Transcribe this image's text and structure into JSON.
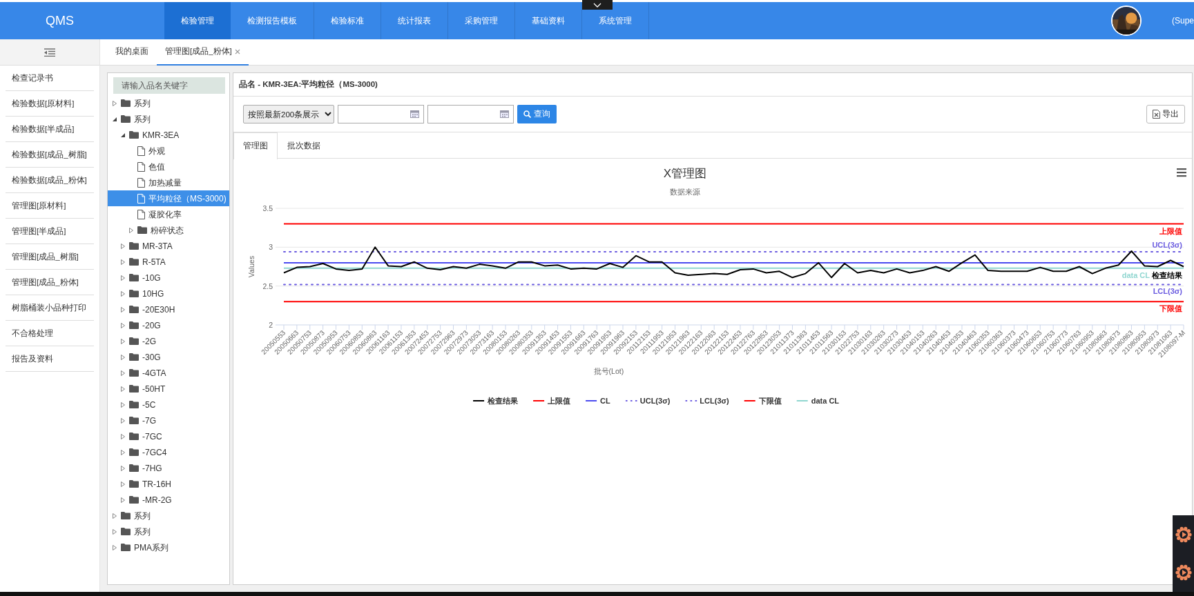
{
  "header": {
    "logo_text": "QMS",
    "menu": [
      {
        "label": "检验管理",
        "selected": true
      },
      {
        "label": "检测报告模板",
        "selected": false
      },
      {
        "label": "检验标准",
        "selected": false
      },
      {
        "label": "统计报表",
        "selected": false
      },
      {
        "label": "采购管理",
        "selected": false
      },
      {
        "label": "基础资料",
        "selected": false
      },
      {
        "label": "系统管理",
        "selected": false
      }
    ],
    "user": "(Supe"
  },
  "sidebar": {
    "items": [
      "检查记录书",
      "检验数据[原材料]",
      "检验数据[半成品]",
      "检验数据[成品_树脂]",
      "检验数据[成品_粉体]",
      "管理图[原材料]",
      "管理图[半成品]",
      "管理图[成品_树脂]",
      "管理图[成品_粉体]",
      "树脂桶装小品种打印",
      "不合格处理",
      "报告及资料"
    ]
  },
  "tabs": [
    {
      "label": "我的桌面",
      "selected": false,
      "closable": false
    },
    {
      "label": "管理图[成品_粉体]",
      "selected": true,
      "closable": true
    }
  ],
  "tree": {
    "placeholder": "请输入品名关键字",
    "nodes": [
      {
        "label": "系列",
        "kind": "folder",
        "expanded": false,
        "selected": false
      },
      {
        "label": "系列",
        "kind": "folder",
        "expanded": true,
        "selected": false,
        "children": [
          {
            "label": "KMR-3EA",
            "kind": "folder",
            "expanded": true,
            "selected": false,
            "children": [
              {
                "label": "外观",
                "kind": "file",
                "selected": false
              },
              {
                "label": "色值",
                "kind": "file",
                "selected": false
              },
              {
                "label": "加热减量",
                "kind": "file",
                "selected": false
              },
              {
                "label": "平均粒径（MS-3000)",
                "kind": "file",
                "selected": true
              },
              {
                "label": "凝胶化率",
                "kind": "file",
                "selected": false
              },
              {
                "label": "粉碎状态",
                "kind": "folder",
                "expanded": false,
                "selected": false
              }
            ]
          },
          {
            "label": "MR-3TA",
            "kind": "folder",
            "expanded": false,
            "selected": false
          },
          {
            "label": "R-5TA",
            "kind": "folder",
            "expanded": false,
            "selected": false
          },
          {
            "label": "-10G",
            "kind": "folder",
            "expanded": false,
            "selected": false
          },
          {
            "label": "10HG",
            "kind": "folder",
            "expanded": false,
            "selected": false
          },
          {
            "label": "-20E30H",
            "kind": "folder",
            "expanded": false,
            "selected": false
          },
          {
            "label": "-20G",
            "kind": "folder",
            "expanded": false,
            "selected": false
          },
          {
            "label": "-2G",
            "kind": "folder",
            "expanded": false,
            "selected": false
          },
          {
            "label": "-30G",
            "kind": "folder",
            "expanded": false,
            "selected": false
          },
          {
            "label": "-4GTA",
            "kind": "folder",
            "expanded": false,
            "selected": false
          },
          {
            "label": "-50HT",
            "kind": "folder",
            "expanded": false,
            "selected": false
          },
          {
            "label": "-5C",
            "kind": "folder",
            "expanded": false,
            "selected": false
          },
          {
            "label": "-7G",
            "kind": "folder",
            "expanded": false,
            "selected": false
          },
          {
            "label": "-7GC",
            "kind": "folder",
            "expanded": false,
            "selected": false
          },
          {
            "label": "-7GC4",
            "kind": "folder",
            "expanded": false,
            "selected": false
          },
          {
            "label": "-7HG",
            "kind": "folder",
            "expanded": false,
            "selected": false
          },
          {
            "label": "TR-16H",
            "kind": "folder",
            "expanded": false,
            "selected": false
          },
          {
            "label": "-MR-2G",
            "kind": "folder",
            "expanded": false,
            "selected": false
          }
        ]
      },
      {
        "label": "系列",
        "kind": "folder",
        "expanded": false,
        "selected": false
      },
      {
        "label": "系列",
        "kind": "folder",
        "expanded": false,
        "selected": false
      },
      {
        "label": "PMA系列",
        "kind": "folder",
        "expanded": false,
        "selected": false
      }
    ]
  },
  "panel": {
    "title": "品名 - KMR-3EA:平均粒径（MS-3000)",
    "toolbar": {
      "display_select": "按照最新200条展示",
      "query_button": "查询",
      "export_button": "导出"
    },
    "view_tabs": [
      {
        "label": "管理图",
        "selected": true
      },
      {
        "label": "批次数据",
        "selected": false
      }
    ],
    "chart": {
      "subtitle": "数据来源",
      "chart_data": {
        "type": "line",
        "title": "X管理图",
        "xlabel": "批号(Lot)",
        "ylabel": "Values",
        "ylim": [
          2,
          3.5
        ],
        "yticks": [
          2,
          2.5,
          3,
          3.5
        ],
        "categories": [
          "20050553",
          "20050663",
          "20050753",
          "20050873",
          "20050953",
          "20060753",
          "20060853",
          "20060863",
          "20061163",
          "20061153",
          "20061353",
          "20072453",
          "20072753",
          "20072963",
          "20072973",
          "20073053",
          "20073163",
          "20080153",
          "20080263",
          "20080353",
          "20091353",
          "20091453",
          "20091553",
          "20091663",
          "20091763",
          "20091953",
          "20091963",
          "20092153",
          "20112153",
          "20111953",
          "20121953",
          "20121963",
          "20122163",
          "20122063",
          "20122153",
          "20122453",
          "20122763",
          "20122853",
          "20123053",
          "21011373",
          "21011363",
          "21011453",
          "21011563",
          "21030153",
          "21022753",
          "21030163",
          "21030263",
          "21030273",
          "21030453",
          "21040153",
          "21040263",
          "21040453",
          "21040353",
          "21040463",
          "21060353",
          "21060363",
          "21060373",
          "21060473",
          "21060653",
          "21060753",
          "21060773",
          "21060763",
          "21060953",
          "21080663",
          "21080673",
          "21080863",
          "21080953",
          "21080973",
          "21081063",
          "2108097-M"
        ],
        "series": [
          {
            "name": "检查结果",
            "color": "#000000",
            "line_style": "solid",
            "values": [
              2.67,
              2.74,
              2.75,
              2.79,
              2.72,
              2.7,
              2.72,
              3.0,
              2.76,
              2.75,
              2.81,
              2.73,
              2.71,
              2.75,
              2.73,
              2.78,
              2.76,
              2.73,
              2.81,
              2.81,
              2.76,
              2.77,
              2.72,
              2.73,
              2.72,
              2.79,
              2.74,
              2.89,
              2.81,
              2.81,
              2.67,
              2.64,
              2.65,
              2.66,
              2.65,
              2.71,
              2.72,
              2.67,
              2.69,
              2.61,
              2.66,
              2.8,
              2.61,
              2.79,
              2.67,
              2.7,
              2.67,
              2.72,
              2.67,
              2.7,
              2.75,
              2.69,
              2.8,
              2.9,
              2.7,
              2.69,
              2.69,
              2.69,
              2.74,
              2.69,
              2.69,
              2.75,
              2.66,
              2.73,
              2.77,
              2.95,
              2.76,
              2.75,
              2.83,
              2.75
            ]
          },
          {
            "name": "上限值",
            "color": "#ff0000",
            "line_style": "solid",
            "values": [
              3.3,
              3.3,
              3.3,
              3.3,
              3.3,
              3.3,
              3.3,
              3.3,
              3.3,
              3.3,
              3.3,
              3.3,
              3.3,
              3.3,
              3.3,
              3.3,
              3.3,
              3.3,
              3.3,
              3.3,
              3.3,
              3.3,
              3.3,
              3.3,
              3.3,
              3.3,
              3.3,
              3.3,
              3.3,
              3.3,
              3.3,
              3.3,
              3.3,
              3.3,
              3.3,
              3.3,
              3.3,
              3.3,
              3.3,
              3.3,
              3.3,
              3.3,
              3.3,
              3.3,
              3.3,
              3.3,
              3.3,
              3.3,
              3.3,
              3.3,
              3.3,
              3.3,
              3.3,
              3.3,
              3.3,
              3.3,
              3.3,
              3.3,
              3.3,
              3.3,
              3.3,
              3.3,
              3.3,
              3.3,
              3.3,
              3.3,
              3.3,
              3.3,
              3.3,
              3.3
            ]
          },
          {
            "name": "CL",
            "color": "#4b4bf0",
            "line_style": "solid",
            "values": [
              2.8,
              2.8,
              2.8,
              2.8,
              2.8,
              2.8,
              2.8,
              2.8,
              2.8,
              2.8,
              2.8,
              2.8,
              2.8,
              2.8,
              2.8,
              2.8,
              2.8,
              2.8,
              2.8,
              2.8,
              2.8,
              2.8,
              2.8,
              2.8,
              2.8,
              2.8,
              2.8,
              2.8,
              2.8,
              2.8,
              2.8,
              2.8,
              2.8,
              2.8,
              2.8,
              2.8,
              2.8,
              2.8,
              2.8,
              2.8,
              2.8,
              2.8,
              2.8,
              2.8,
              2.8,
              2.8,
              2.8,
              2.8,
              2.8,
              2.8,
              2.8,
              2.8,
              2.8,
              2.8,
              2.8,
              2.8,
              2.8,
              2.8,
              2.8,
              2.8,
              2.8,
              2.8,
              2.8,
              2.8,
              2.8,
              2.8,
              2.8,
              2.8,
              2.8,
              2.8
            ]
          },
          {
            "name": "UCL(3σ)",
            "color": "#6a5be0",
            "line_style": "dotted",
            "values": [
              2.94,
              2.94,
              2.94,
              2.94,
              2.94,
              2.94,
              2.94,
              2.94,
              2.94,
              2.94,
              2.94,
              2.94,
              2.94,
              2.94,
              2.94,
              2.94,
              2.94,
              2.94,
              2.94,
              2.94,
              2.94,
              2.94,
              2.94,
              2.94,
              2.94,
              2.94,
              2.94,
              2.94,
              2.94,
              2.94,
              2.94,
              2.94,
              2.94,
              2.94,
              2.94,
              2.94,
              2.94,
              2.94,
              2.94,
              2.94,
              2.94,
              2.94,
              2.94,
              2.94,
              2.94,
              2.94,
              2.94,
              2.94,
              2.94,
              2.94,
              2.94,
              2.94,
              2.94,
              2.94,
              2.94,
              2.94,
              2.94,
              2.94,
              2.94,
              2.94,
              2.94,
              2.94,
              2.94,
              2.94,
              2.94,
              2.94,
              2.94,
              2.94,
              2.94,
              2.94
            ]
          },
          {
            "name": "LCL(3σ)",
            "color": "#6a5be0",
            "line_style": "dotted",
            "values": [
              2.52,
              2.52,
              2.52,
              2.52,
              2.52,
              2.52,
              2.52,
              2.52,
              2.52,
              2.52,
              2.52,
              2.52,
              2.52,
              2.52,
              2.52,
              2.52,
              2.52,
              2.52,
              2.52,
              2.52,
              2.52,
              2.52,
              2.52,
              2.52,
              2.52,
              2.52,
              2.52,
              2.52,
              2.52,
              2.52,
              2.52,
              2.52,
              2.52,
              2.52,
              2.52,
              2.52,
              2.52,
              2.52,
              2.52,
              2.52,
              2.52,
              2.52,
              2.52,
              2.52,
              2.52,
              2.52,
              2.52,
              2.52,
              2.52,
              2.52,
              2.52,
              2.52,
              2.52,
              2.52,
              2.52,
              2.52,
              2.52,
              2.52,
              2.52,
              2.52,
              2.52,
              2.52,
              2.52,
              2.52,
              2.52,
              2.52,
              2.52,
              2.52,
              2.52,
              2.52
            ]
          },
          {
            "name": "下限值",
            "color": "#ff0000",
            "line_style": "solid",
            "values": [
              2.3,
              2.3,
              2.3,
              2.3,
              2.3,
              2.3,
              2.3,
              2.3,
              2.3,
              2.3,
              2.3,
              2.3,
              2.3,
              2.3,
              2.3,
              2.3,
              2.3,
              2.3,
              2.3,
              2.3,
              2.3,
              2.3,
              2.3,
              2.3,
              2.3,
              2.3,
              2.3,
              2.3,
              2.3,
              2.3,
              2.3,
              2.3,
              2.3,
              2.3,
              2.3,
              2.3,
              2.3,
              2.3,
              2.3,
              2.3,
              2.3,
              2.3,
              2.3,
              2.3,
              2.3,
              2.3,
              2.3,
              2.3,
              2.3,
              2.3,
              2.3,
              2.3,
              2.3,
              2.3,
              2.3,
              2.3,
              2.3,
              2.3,
              2.3,
              2.3,
              2.3,
              2.3,
              2.3,
              2.3,
              2.3,
              2.3,
              2.3,
              2.3,
              2.3,
              2.3
            ]
          },
          {
            "name": "data CL",
            "color": "#8fd6d0",
            "line_style": "solid",
            "values": [
              2.73,
              2.73,
              2.73,
              2.73,
              2.73,
              2.73,
              2.73,
              2.73,
              2.73,
              2.73,
              2.73,
              2.73,
              2.73,
              2.73,
              2.73,
              2.73,
              2.73,
              2.73,
              2.73,
              2.73,
              2.73,
              2.73,
              2.73,
              2.73,
              2.73,
              2.73,
              2.73,
              2.73,
              2.73,
              2.73,
              2.73,
              2.73,
              2.73,
              2.73,
              2.73,
              2.73,
              2.73,
              2.73,
              2.73,
              2.73,
              2.73,
              2.73,
              2.73,
              2.73,
              2.73,
              2.73,
              2.73,
              2.73,
              2.73,
              2.73,
              2.73,
              2.73,
              2.73,
              2.73,
              2.73,
              2.73,
              2.73,
              2.73,
              2.73,
              2.73,
              2.73,
              2.73,
              2.73,
              2.73,
              2.73,
              2.73,
              2.73,
              2.73,
              2.73,
              2.73
            ]
          }
        ],
        "legend": "bottom",
        "annotations": [
          "上限值",
          "UCL(3σ)",
          "检查结果",
          "data CL",
          "LCL(3σ)",
          "下限值"
        ]
      }
    }
  }
}
